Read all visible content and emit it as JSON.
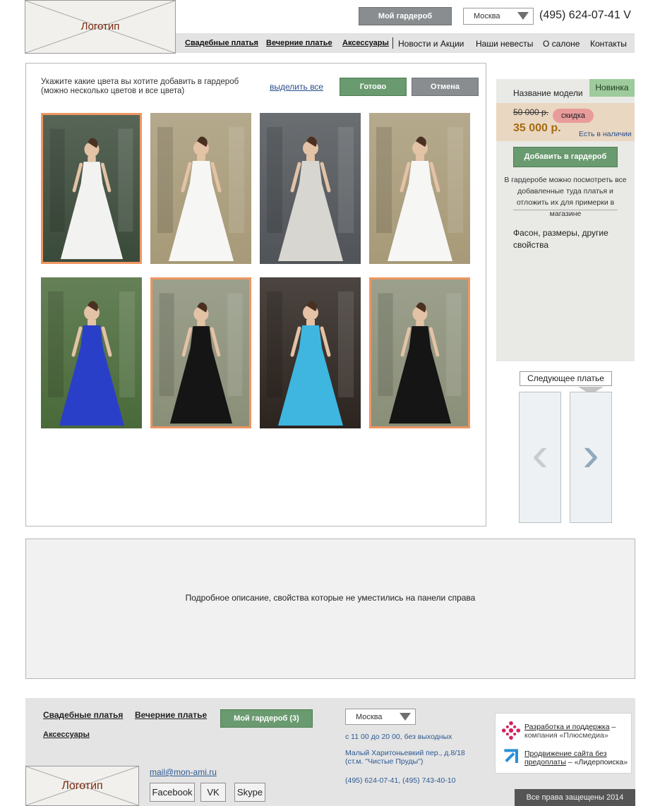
{
  "header": {
    "logo_text": "Логотип",
    "wardrobe_button": "Мой гардероб",
    "city_select": "Москва",
    "phone": "(495) 624-07-41 V"
  },
  "nav": {
    "items": [
      {
        "label": "Свадебные платья"
      },
      {
        "label": "Вечерние платье"
      },
      {
        "label": "Аксессуары"
      },
      {
        "label": "Новости и Акции"
      },
      {
        "label": "Наши невесты"
      },
      {
        "label": "О салоне"
      },
      {
        "label": "Контакты"
      }
    ]
  },
  "picker": {
    "instruction_line1": "Укажите какие цвета вы хотите добавить в гардероб",
    "instruction_line2": "(можно несколько цветов и все цвета)",
    "select_all": "выделить все",
    "done_button": "Готово",
    "cancel_button": "Отмена",
    "thumbnails": [
      {
        "name": "white-ballgown-garden",
        "selected": true,
        "dress": "#f2f2f0",
        "bg": "#3a4a3a"
      },
      {
        "name": "white-mermaid-palace",
        "selected": false,
        "dress": "#f6f6f4",
        "bg": "#a79a78"
      },
      {
        "name": "lace-gown-doorway",
        "selected": false,
        "dress": "#d8d6d0",
        "bg": "#505458"
      },
      {
        "name": "white-mermaid-palace-2",
        "selected": false,
        "dress": "#f6f6f4",
        "bg": "#a79a78"
      },
      {
        "name": "blue-gown-garden",
        "selected": false,
        "dress": "#2a3fc8",
        "bg": "#4a6a3a"
      },
      {
        "name": "black-gown-columns",
        "selected": true,
        "dress": "#151515",
        "bg": "#8a8f78"
      },
      {
        "name": "turquoise-gown-door",
        "selected": false,
        "dress": "#3fb6e0",
        "bg": "#2c241f"
      },
      {
        "name": "black-gown-columns-2",
        "selected": true,
        "dress": "#151515",
        "bg": "#8a8f78"
      }
    ]
  },
  "product": {
    "new_badge": "Новинка",
    "model_name": "Название модели",
    "old_price": "50 000 р.",
    "discount_badge": "скидка",
    "price": "35 000 р.",
    "availability": "Есть в наличии",
    "add_button": "Добавить в гардероб",
    "note": "В гардеробе можно посмотреть все добавленные туда платья и отложить их для примерки в магазине",
    "properties": "Фасон, размеры, другие свойства"
  },
  "next_dress": {
    "label": "Следующее платье",
    "prev_arrow": "‹",
    "next_arrow": "›"
  },
  "description": {
    "text": "Подробное описание, свойства которые не уместились на панели справа"
  },
  "footer": {
    "link_wedding": "Свадебные платья",
    "link_evening": "Вечерние платье",
    "link_accessories": "Аксессуары",
    "wardrobe_button": "Мой гардероб (3)",
    "city_select": "Москва",
    "hours": "с 11 00 до 20 00, без выходных",
    "address_line1": "Малый Харитоньевкий пер., д.8/18",
    "address_line2": "(ст.м. \"Чистые Пруды\")",
    "phones": "(495) 624-07-41, (495) 743-40-10",
    "email": "mail@mon-ami.ru",
    "social": [
      "Facebook",
      "VK",
      "Skype"
    ],
    "logo_text": "Логотип",
    "credit1_link": "Разработка и поддержка",
    "credit1_dash": " –",
    "credit1_company": "компания «Плюсмедиа»",
    "credit2_link_a": "Продвижение сайта без",
    "credit2_link_b": "предоплаты",
    "credit2_company": " – «Лидерпоиска»",
    "copyright": "Все права защещены 2014"
  }
}
